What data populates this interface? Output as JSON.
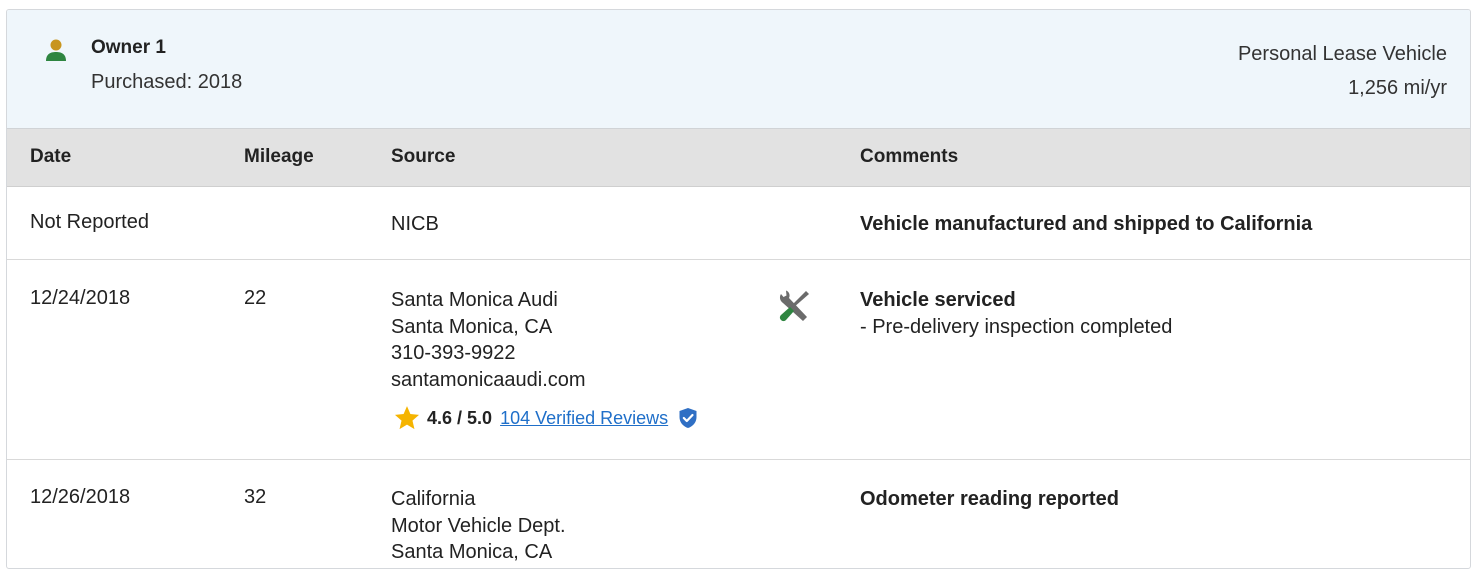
{
  "owner": {
    "title": "Owner 1",
    "purchased": "Purchased: 2018",
    "vehicle_type": "Personal Lease Vehicle",
    "mileage_per_year": "1,256 mi/yr",
    "icon": "person-icon",
    "icon_color_head": "#c8951e",
    "icon_color_body": "#2e8540"
  },
  "table": {
    "headers": {
      "date": "Date",
      "mileage": "Mileage",
      "source": "Source",
      "comments": "Comments"
    },
    "rows": [
      {
        "date": "Not Reported",
        "mileage": "",
        "source": [
          "NICB"
        ],
        "comment_title": "Vehicle manufactured and shipped to California"
      },
      {
        "date": "12/24/2018",
        "mileage": "22",
        "source": [
          "Santa Monica Audi",
          "Santa Monica, CA",
          "310-393-9922",
          "santamonicaaudi.com"
        ],
        "rating_score": "4.6 / 5.0",
        "rating_value": 4.6,
        "rating_max": 5.0,
        "reviews_link": "104 Verified Reviews",
        "icon": "service-tools-icon",
        "comment_title": "Vehicle serviced",
        "comment_sub": "- Pre-delivery inspection completed"
      },
      {
        "date": "12/26/2018",
        "mileage": "32",
        "source": [
          "California",
          "Motor Vehicle Dept.",
          "Santa Monica, CA"
        ],
        "comment_title": "Odometer reading reported"
      }
    ]
  },
  "colors": {
    "header_bg": "#eff6fb",
    "table_head_bg": "#e2e2e2",
    "link": "#1f6fc9",
    "star": "#f5b400",
    "verified_shield": "#2f6fc4",
    "tool_green": "#2e8540",
    "tool_gray": "#6b6b6b"
  }
}
